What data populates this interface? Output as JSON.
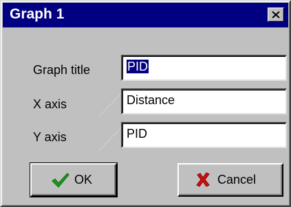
{
  "window": {
    "title": "Graph 1",
    "close_icon": "close-icon"
  },
  "fields": [
    {
      "label": "Graph title",
      "value": "PID",
      "selected": true
    },
    {
      "label": "X axis",
      "value": "Distance",
      "selected": false
    },
    {
      "label": "Y axis",
      "value": "PID",
      "selected": false
    }
  ],
  "buttons": {
    "ok_label": "OK",
    "ok_icon": "checkmark-icon",
    "cancel_label": "Cancel",
    "cancel_icon": "red-x-icon"
  },
  "colors": {
    "titlebar": "#000080",
    "face": "#c0c0c0",
    "selection": "#000080",
    "check_green": "#1a9a1a",
    "cancel_red": "#cc1010"
  }
}
